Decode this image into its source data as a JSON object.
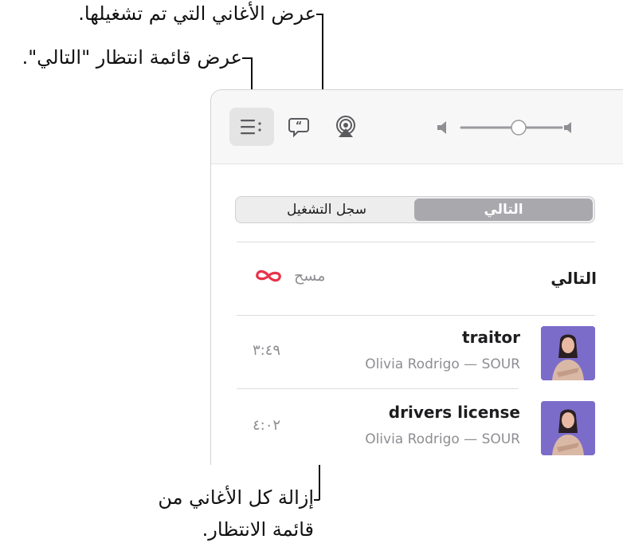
{
  "callouts": {
    "history": "عرض الأغاني التي تم تشغيلها.",
    "queue": "عرض قائمة انتظار \"التالي\".",
    "clear_line1": "إزالة كل الأغاني من",
    "clear_line2": "قائمة الانتظار."
  },
  "toolbar": {
    "queue_icon": "list-icon",
    "lyrics_icon": "lyrics-bubble-icon",
    "airplay_icon": "airplay-icon",
    "volume_level": 0.45
  },
  "segmented": {
    "next": "التالي",
    "history": "سجل التشغيل",
    "selected": "next"
  },
  "queue": {
    "title": "التالي",
    "clear_label": "مسح",
    "autoplay_icon": "infinity-icon",
    "autoplay_color": "#e8334a",
    "songs": [
      {
        "title": "traitor",
        "subtitle": "Olivia Rodrigo — SOUR",
        "duration": "٣:٤٩"
      },
      {
        "title": "drivers license",
        "subtitle": "Olivia Rodrigo — SOUR",
        "duration": "٤:٠٢"
      }
    ]
  }
}
